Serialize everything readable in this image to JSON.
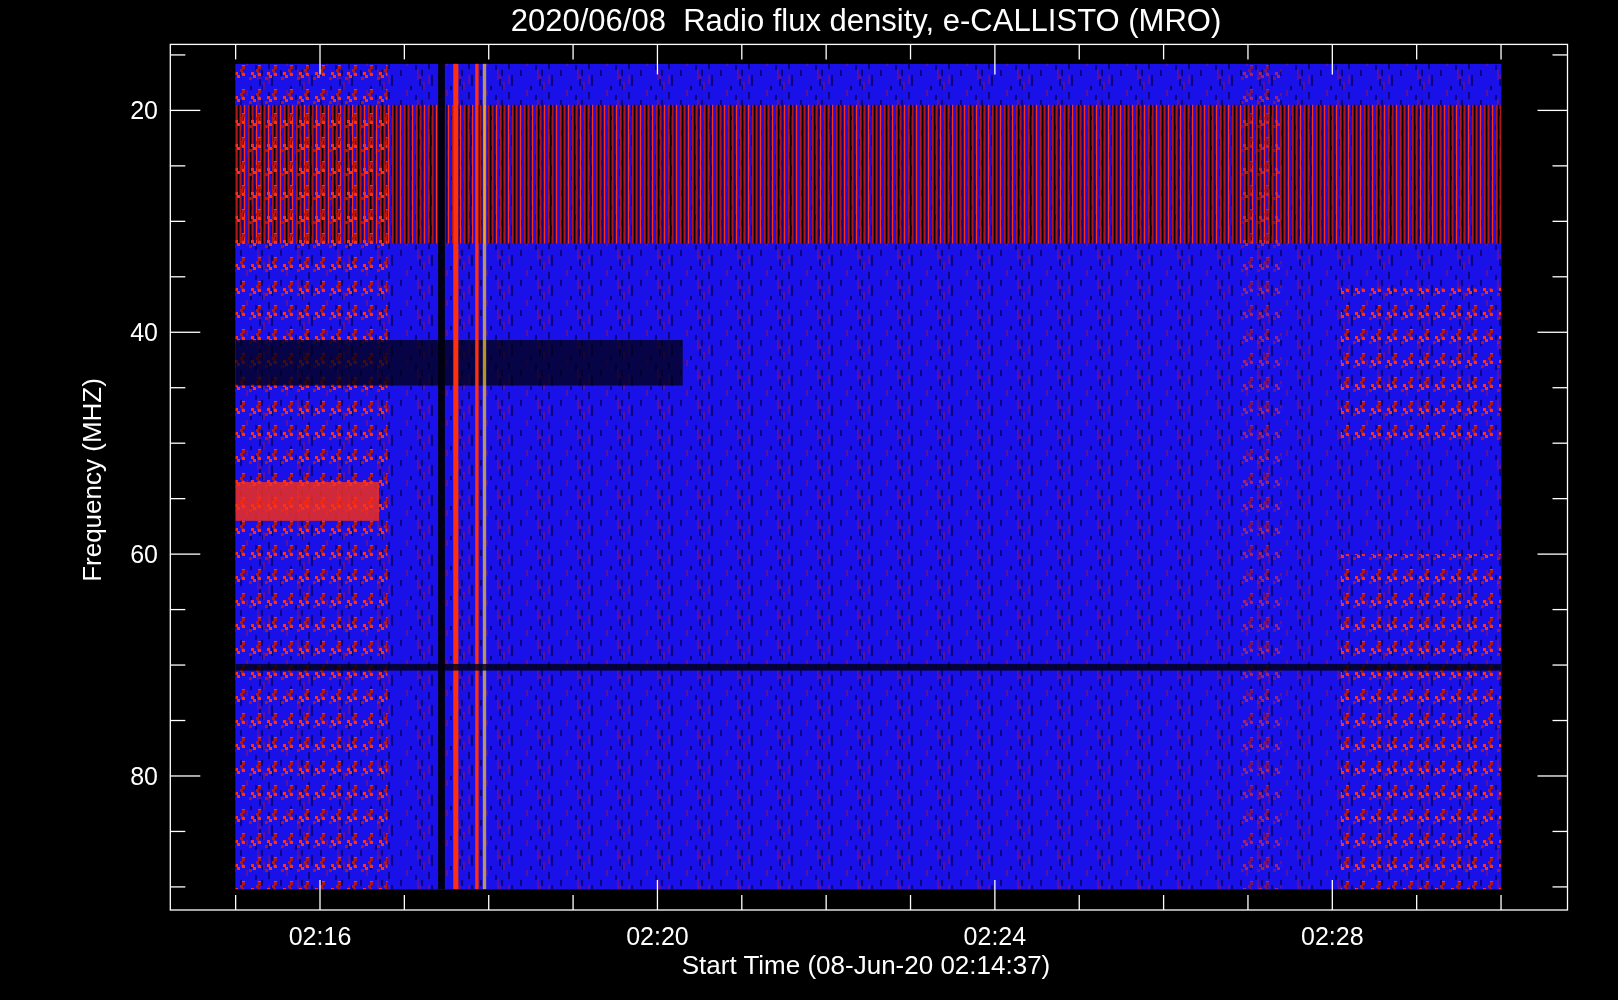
{
  "title": "2020/06/08  Radio flux density, e-CALLISTO (MRO)",
  "y_axis": {
    "label": "Frequency (MHZ)",
    "tick_labels": [
      "20",
      "40",
      "60",
      "80"
    ]
  },
  "x_axis": {
    "label": "Start Time (08-Jun-20 02:14:37)",
    "tick_labels": [
      "02:16",
      "02:20",
      "02:24",
      "02:28"
    ]
  }
}
